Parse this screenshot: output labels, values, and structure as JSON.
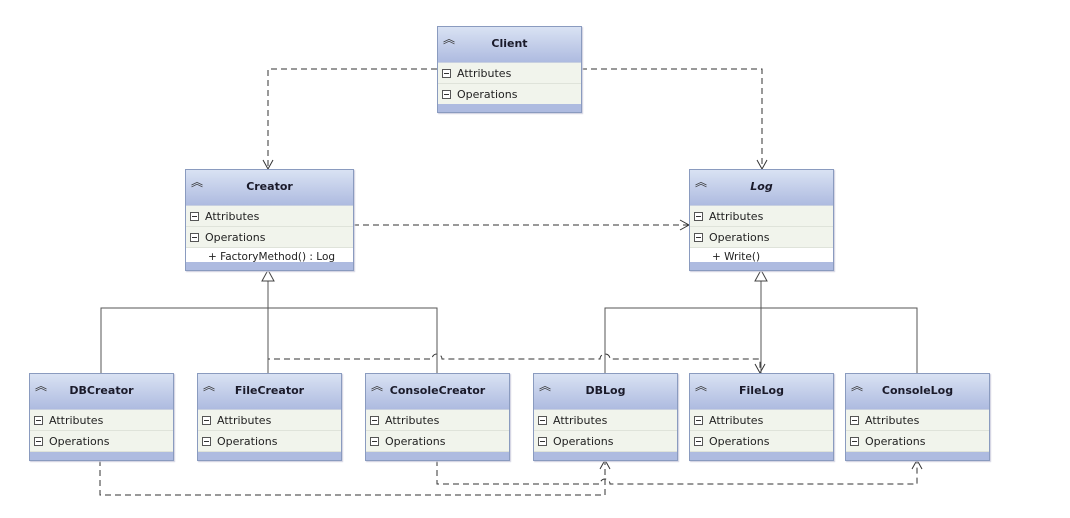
{
  "classes": {
    "client": {
      "name": "Client",
      "attributes": "Attributes",
      "operations": "Operations"
    },
    "creator": {
      "name": "Creator",
      "attributes": "Attributes",
      "operations": "Operations",
      "op1": "+ FactoryMethod() : Log"
    },
    "log": {
      "name": "Log",
      "abstract": true,
      "attributes": "Attributes",
      "operations": "Operations",
      "op1": "+ Write()"
    },
    "dbcreator": {
      "name": "DBCreator",
      "attributes": "Attributes",
      "operations": "Operations"
    },
    "filecreator": {
      "name": "FileCreator",
      "attributes": "Attributes",
      "operations": "Operations"
    },
    "consolecreator": {
      "name": "ConsoleCreator",
      "attributes": "Attributes",
      "operations": "Operations"
    },
    "dblog": {
      "name": "DBLog",
      "attributes": "Attributes",
      "operations": "Operations"
    },
    "filelog": {
      "name": "FileLog",
      "attributes": "Attributes",
      "operations": "Operations"
    },
    "consolelog": {
      "name": "ConsoleLog",
      "attributes": "Attributes",
      "operations": "Operations"
    }
  },
  "relations": [
    {
      "from": "Client",
      "to": "Creator",
      "type": "dependency"
    },
    {
      "from": "Client",
      "to": "Log",
      "type": "dependency"
    },
    {
      "from": "Creator",
      "to": "Log",
      "type": "dependency"
    },
    {
      "from": "DBCreator",
      "to": "Creator",
      "type": "generalization"
    },
    {
      "from": "FileCreator",
      "to": "Creator",
      "type": "generalization"
    },
    {
      "from": "ConsoleCreator",
      "to": "Creator",
      "type": "generalization"
    },
    {
      "from": "DBLog",
      "to": "Log",
      "type": "generalization"
    },
    {
      "from": "FileLog",
      "to": "Log",
      "type": "generalization"
    },
    {
      "from": "ConsoleLog",
      "to": "Log",
      "type": "generalization"
    },
    {
      "from": "DBCreator",
      "to": "DBLog",
      "type": "dependency"
    },
    {
      "from": "FileCreator",
      "to": "FileLog",
      "type": "dependency"
    },
    {
      "from": "ConsoleCreator",
      "to": "ConsoleLog",
      "type": "dependency"
    }
  ],
  "colors": {
    "header": "#aebbe0",
    "compartment": "#f1f4ec",
    "border": "#8a9bbf",
    "line": "#444444"
  }
}
